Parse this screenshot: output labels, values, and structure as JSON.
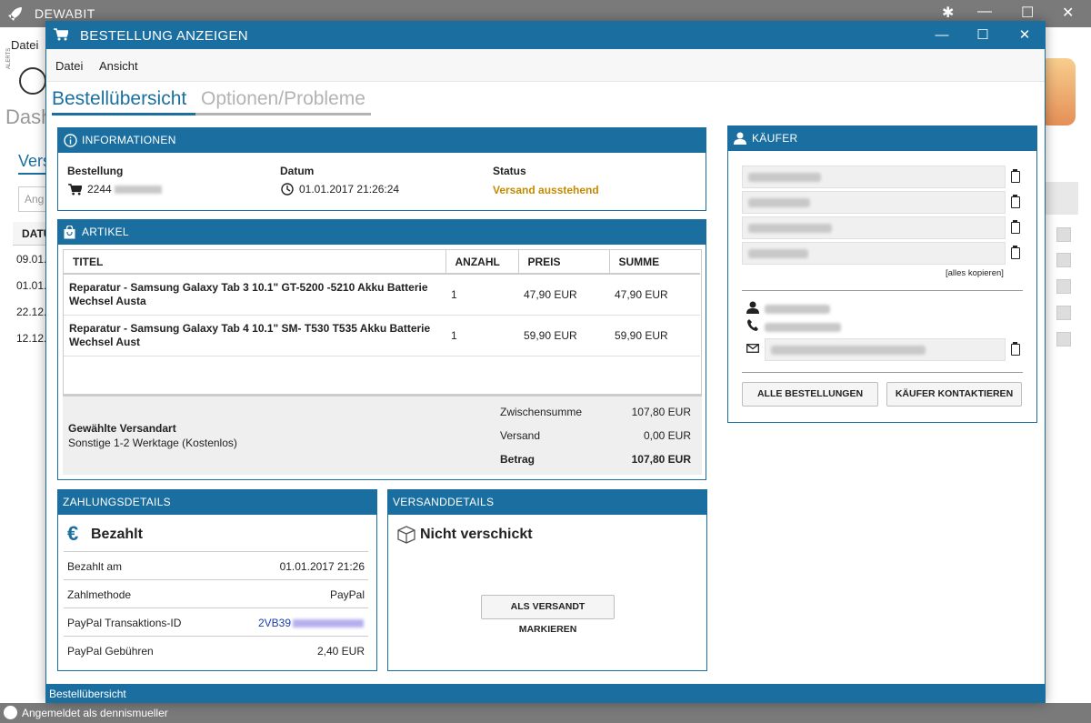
{
  "bg_app": {
    "title": "DEWABIT",
    "menu_datei": "Datei",
    "alerts_label": "ALERTS",
    "dashboard_label": "Dash",
    "tab_label": "Vers",
    "search_placeholder": "Ang",
    "table_header": "DATU",
    "rows": [
      "09.01.",
      "01.01.",
      "22.12.",
      "12.12."
    ],
    "status_user": "Angemeldet als dennismueller",
    "wc_min": "—",
    "wc_max": "☐",
    "wc_close": "✕"
  },
  "window": {
    "title": "BESTELLUNG ANZEIGEN",
    "wc_min": "—",
    "wc_max": "☐",
    "wc_close": "✕",
    "menu": {
      "file": "Datei",
      "view": "Ansicht"
    },
    "tabs": {
      "overview": "Bestellübersicht",
      "options": "Optionen/Probleme"
    },
    "statusbar": "Bestellübersicht"
  },
  "info": {
    "heading": "INFORMATIONEN",
    "order_label": "Bestellung",
    "order_value": "2244",
    "date_label": "Datum",
    "date_value": "01.01.2017 21:26:24",
    "status_label": "Status",
    "status_value": "Versand ausstehend"
  },
  "articles": {
    "heading": "ARTIKEL",
    "columns": [
      "TITEL",
      "ANZAHL",
      "PREIS",
      "SUMME"
    ],
    "rows": [
      {
        "title": "Reparatur - Samsung Galaxy Tab 3 10.1\" GT-5200 -5210 Akku Batterie Wechsel Austa",
        "qty": "1",
        "price": "47,90 EUR",
        "sum": "47,90 EUR"
      },
      {
        "title": "Reparatur - Samsung Galaxy Tab 4 10.1\" SM- T530 T535  Akku Batterie Wechsel Aust",
        "qty": "1",
        "price": "59,90 EUR",
        "sum": "59,90 EUR"
      }
    ],
    "shipping_label": "Gewählte Versandart",
    "shipping_value": "Sonstige 1-2 Werktage (Kostenlos)",
    "subtotal_label": "Zwischensumme",
    "subtotal_value": "107,80 EUR",
    "shipping_cost_label": "Versand",
    "shipping_cost_value": "0,00 EUR",
    "total_label": "Betrag",
    "total_value": "107,80 EUR"
  },
  "buyer": {
    "heading": "KÄUFER",
    "copy_all": "[alles kopieren]",
    "btn_all_orders": "ALLE BESTELLUNGEN",
    "btn_contact": "KÄUFER KONTAKTIEREN"
  },
  "payment": {
    "heading": "ZAHLUNGSDETAILS",
    "status": "Bezahlt",
    "rows": [
      {
        "k": "Bezahlt am",
        "v": "01.01.2017 21:26"
      },
      {
        "k": "Zahlmethode",
        "v": "PayPal"
      },
      {
        "k": "PayPal Transaktions-ID",
        "v": "2VB39"
      },
      {
        "k": "PayPal Gebühren",
        "v": "2,40 EUR"
      }
    ]
  },
  "shipping": {
    "heading": "VERSANDDETAILS",
    "status": "Nicht verschickt",
    "btn_mark_shipped": "ALS VERSANDT MARKIEREN"
  },
  "colors": {
    "accent": "#1a6fa0",
    "status_pending": "#c48a00",
    "link": "#1a3fb0"
  }
}
